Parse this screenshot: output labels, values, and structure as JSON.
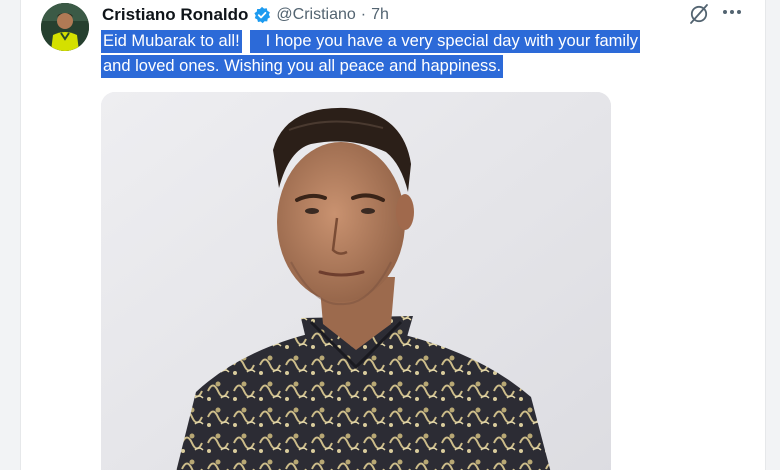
{
  "tweet": {
    "author": {
      "display_name": "Cristiano Ronaldo",
      "handle": "@Cristiano",
      "verified": true,
      "avatar_icon": "avatar-photo"
    },
    "separator": "·",
    "timestamp": "7h",
    "text_line1_part1": "Eid Mubarak to all!",
    "text_line1_part2": "I hope you have a very special day with your family",
    "text_line2": "and loved ones. Wishing you all peace and happiness.",
    "media": {
      "type": "photo"
    },
    "header_icons": [
      "grok-icon",
      "more-icon"
    ],
    "colors": {
      "selection_highlight": "#2c6ad8",
      "verified_badge": "#1d9bf0",
      "muted_text": "#536471"
    }
  }
}
